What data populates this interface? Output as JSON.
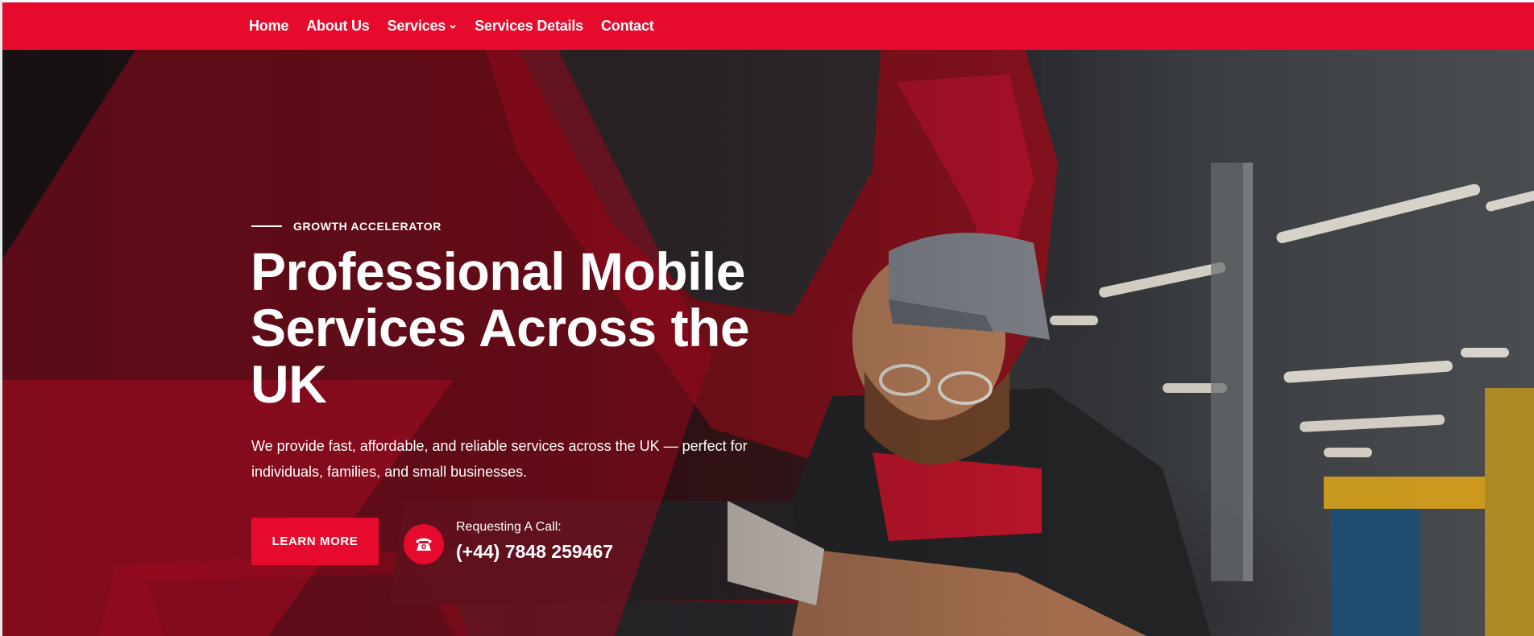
{
  "nav": {
    "items": [
      {
        "label": "Home",
        "has_dropdown": false
      },
      {
        "label": "About Us",
        "has_dropdown": false
      },
      {
        "label": "Services",
        "has_dropdown": true
      },
      {
        "label": "Services Details",
        "has_dropdown": false
      },
      {
        "label": "Contact",
        "has_dropdown": false
      }
    ]
  },
  "hero": {
    "eyebrow": "GROWTH ACCELERATOR",
    "headline_line1": "Professional Mobile",
    "headline_line2": "Services Across the",
    "headline_line3": "UK",
    "description": "We provide fast, affordable, and reliable services across the UK — perfect for individuals, families, and small businesses.",
    "cta_label": "LEARN MORE",
    "call_label": "Requesting A Call:",
    "call_number": "(+44) 7848 259467",
    "phone_icon": "phone-icon"
  },
  "colors": {
    "brand_red": "#e60b2d",
    "text_white": "#ffffff"
  }
}
